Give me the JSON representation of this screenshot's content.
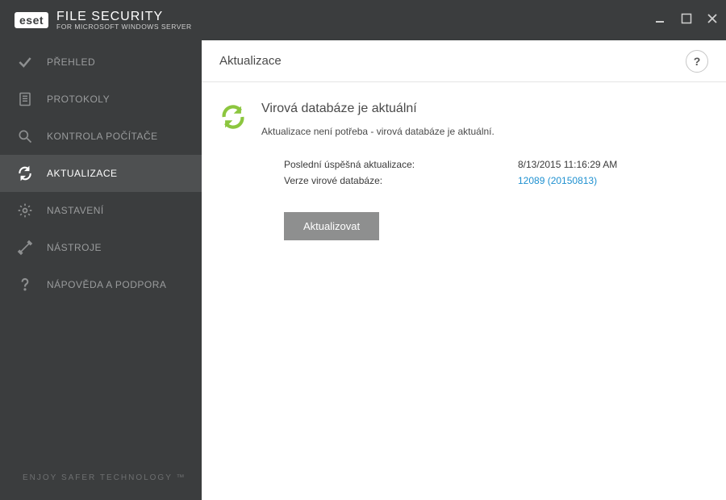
{
  "header": {
    "brand": "eset",
    "title": "FILE SECURITY",
    "subtitle": "FOR MICROSOFT WINDOWS SERVER"
  },
  "sidebar": {
    "items": [
      {
        "label": "PŘEHLED"
      },
      {
        "label": "PROTOKOLY"
      },
      {
        "label": "KONTROLA POČÍTAČE"
      },
      {
        "label": "AKTUALIZACE"
      },
      {
        "label": "NASTAVENÍ"
      },
      {
        "label": "NÁSTROJE"
      },
      {
        "label": "NÁPOVĚDA A PODPORA"
      }
    ],
    "activeIndex": 3,
    "footer": "ENJOY SAFER TECHNOLOGY ™"
  },
  "page": {
    "title": "Aktualizace",
    "help_label": "?",
    "status": {
      "title": "Virová databáze je aktuální",
      "desc": "Aktualizace není potřeba - virová databáze je aktuální."
    },
    "details": {
      "last_update_label": "Poslední úspěšná aktualizace:",
      "last_update_value": "8/13/2015 11:16:29 AM",
      "db_version_label": "Verze virové databáze:",
      "db_version_value": "12089 (20150813)"
    },
    "update_button": "Aktualizovat"
  }
}
